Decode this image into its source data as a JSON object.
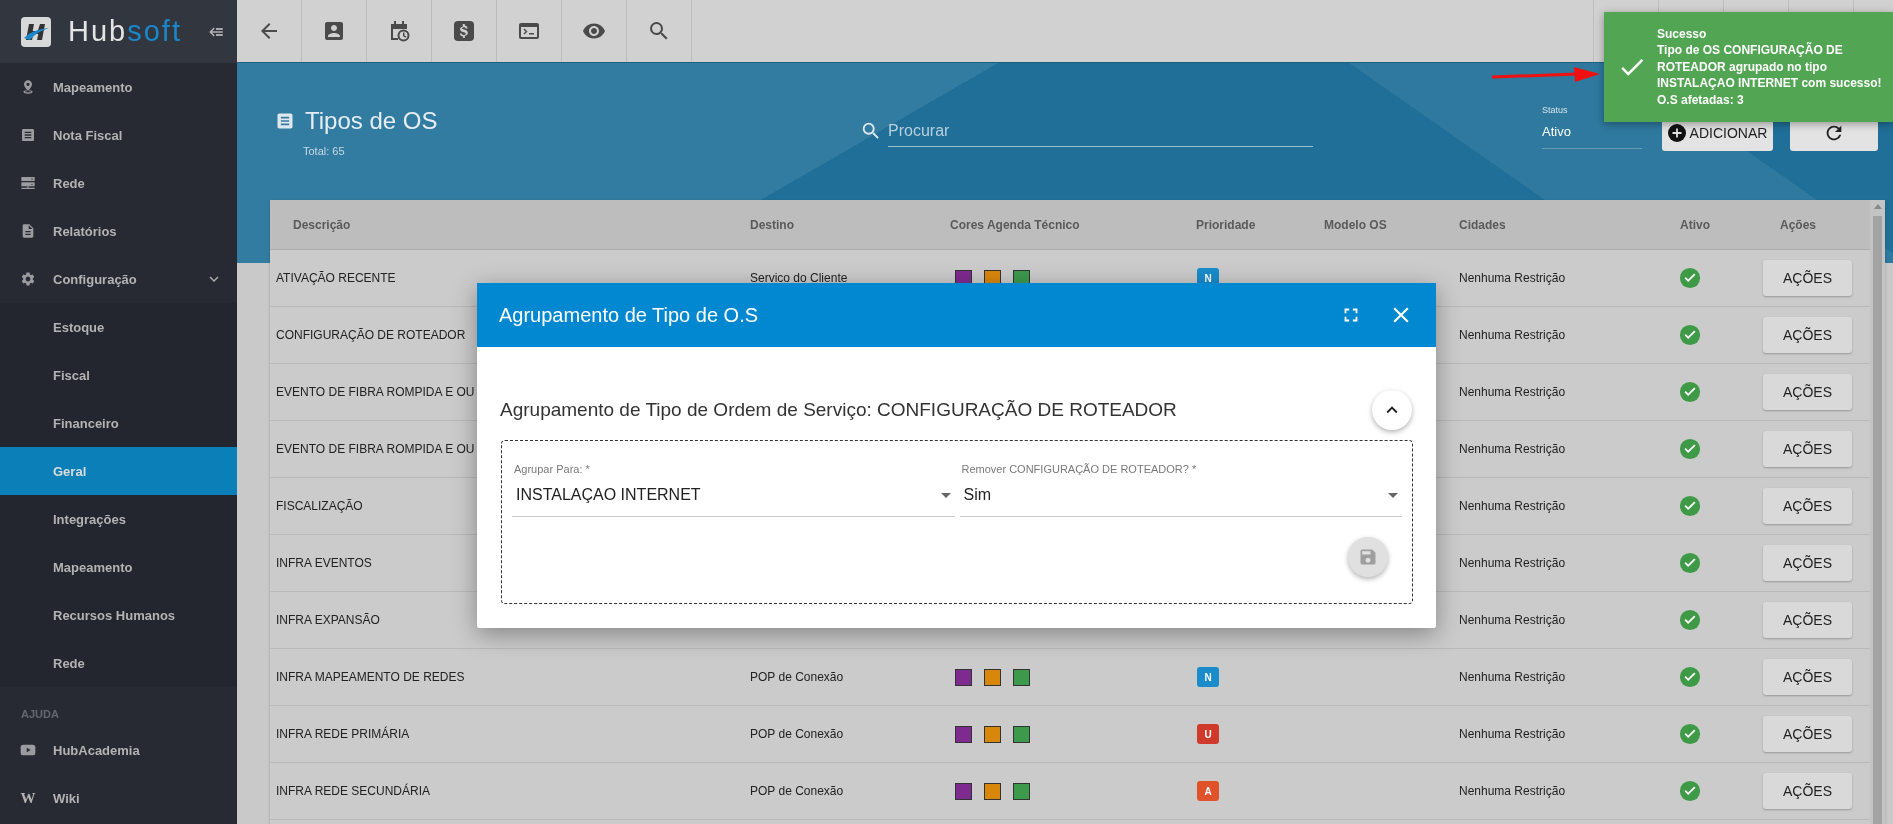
{
  "sidebar": {
    "brand": [
      "Hub",
      "soft"
    ],
    "items": [
      {
        "label": "Mapeamento",
        "selected": false
      },
      {
        "label": "Nota Fiscal",
        "selected": false
      },
      {
        "label": "Rede",
        "selected": false
      },
      {
        "label": "Relatórios",
        "selected": false
      },
      {
        "label": "Configuração",
        "selected": false,
        "expanded": true,
        "children": [
          {
            "label": "Estoque",
            "selected": false
          },
          {
            "label": "Fiscal",
            "selected": false
          },
          {
            "label": "Financeiro",
            "selected": false
          },
          {
            "label": "Geral",
            "selected": true
          },
          {
            "label": "Integrações",
            "selected": false
          },
          {
            "label": "Mapeamento",
            "selected": false
          },
          {
            "label": "Recursos Humanos",
            "selected": false
          },
          {
            "label": "Rede",
            "selected": false
          }
        ]
      }
    ],
    "sections": [
      {
        "title": "AJUDA",
        "items": [
          {
            "label": "HubAcademia",
            "selected": false
          },
          {
            "label": "Wiki",
            "selected": false,
            "glyph": "W"
          }
        ]
      }
    ]
  },
  "page": {
    "title": "Tipos de OS",
    "total": "Total: 65",
    "search": {
      "placeholder": "Procurar"
    },
    "status": {
      "label": "Status",
      "value": "Ativo"
    },
    "buttons": [
      {
        "kind": "add",
        "label": "ADICIONAR"
      },
      {
        "kind": "refresh"
      }
    ]
  },
  "table": {
    "columns": [
      "Descrição",
      "Destino",
      "Cores Agenda Técnico",
      "Prioridade",
      "Modelo OS",
      "Cidades",
      "Ativo",
      "Ações"
    ],
    "rows": [
      {
        "description": "ATIVAÇÃO RECENTE",
        "destination": "Servico do Cliente",
        "colors": [
          {
            "color": "#7e2b8f"
          },
          {
            "color": "#d9870b"
          },
          {
            "color": "#3d9a4d"
          }
        ],
        "priority": {
          "label": "N",
          "color": "#1a8ccc"
        },
        "cities": "Nenhuma Restrição",
        "active": true,
        "action": "AÇÕES"
      },
      {
        "description": "CONFIGURAÇÃO DE ROTEADOR",
        "cities": "Nenhuma Restrição",
        "active": true,
        "action": "AÇÕES"
      },
      {
        "description": "EVENTO DE FIBRA ROMPIDA E OU",
        "cities": "Nenhuma Restrição",
        "active": true,
        "action": "AÇÕES"
      },
      {
        "description": "EVENTO DE FIBRA ROMPIDA E OU",
        "cities": "Nenhuma Restrição",
        "active": true,
        "action": "AÇÕES"
      },
      {
        "description": "FISCALIZAÇÃO",
        "cities": "Nenhuma Restrição",
        "active": true,
        "action": "AÇÕES"
      },
      {
        "description": "INFRA EVENTOS",
        "cities": "Nenhuma Restrição",
        "active": true,
        "action": "AÇÕES"
      },
      {
        "description": "INFRA EXPANSÃO",
        "cities": "Nenhuma Restrição",
        "active": true,
        "action": "AÇÕES"
      },
      {
        "description": "INFRA MAPEAMENTO DE REDES",
        "destination": "POP de Conexão",
        "colors": [
          {
            "color": "#7e2b8f"
          },
          {
            "color": "#d9870b"
          },
          {
            "color": "#3d9a4d"
          }
        ],
        "priority": {
          "label": "N",
          "color": "#1a8ccc"
        },
        "cities": "Nenhuma Restrição",
        "active": true,
        "action": "AÇÕES"
      },
      {
        "description": "INFRA REDE PRIMÁRIA",
        "destination": "POP de Conexão",
        "colors": [
          {
            "color": "#7e2b8f"
          },
          {
            "color": "#d9870b"
          },
          {
            "color": "#3d9a4d"
          }
        ],
        "priority": {
          "label": "U",
          "color": "#d03a2a"
        },
        "cities": "Nenhuma Restrição",
        "active": true,
        "action": "AÇÕES"
      },
      {
        "description": "INFRA REDE SECUNDÁRIA",
        "destination": "POP de Conexão",
        "colors": [
          {
            "color": "#7e2b8f"
          },
          {
            "color": "#d9870b"
          },
          {
            "color": "#3d9a4d"
          }
        ],
        "priority": {
          "label": "A",
          "color": "#e0532a"
        },
        "cities": "Nenhuma Restrição",
        "active": true,
        "action": "AÇÕES"
      }
    ]
  },
  "modal": {
    "title": "Agrupamento de Tipo de O.S",
    "heading": "Agrupamento de Tipo de Ordem de Serviço: CONFIGURAÇÃO DE ROTEADOR",
    "expanded": true,
    "fields": [
      {
        "label": "Agrupar Para: *",
        "value": "INSTALAÇAO INTERNET"
      },
      {
        "label": "Remover CONFIGURAÇÃO DE ROTEADOR? *",
        "value": "Sim"
      }
    ]
  },
  "toast": {
    "title": "Sucesso",
    "message": "Tipo de OS CONFIGURAÇÃO DE ROTEADOR agrupado no tipo INSTALAÇAO INTERNET com sucesso!",
    "detail": "O.S afetadas: 3"
  }
}
